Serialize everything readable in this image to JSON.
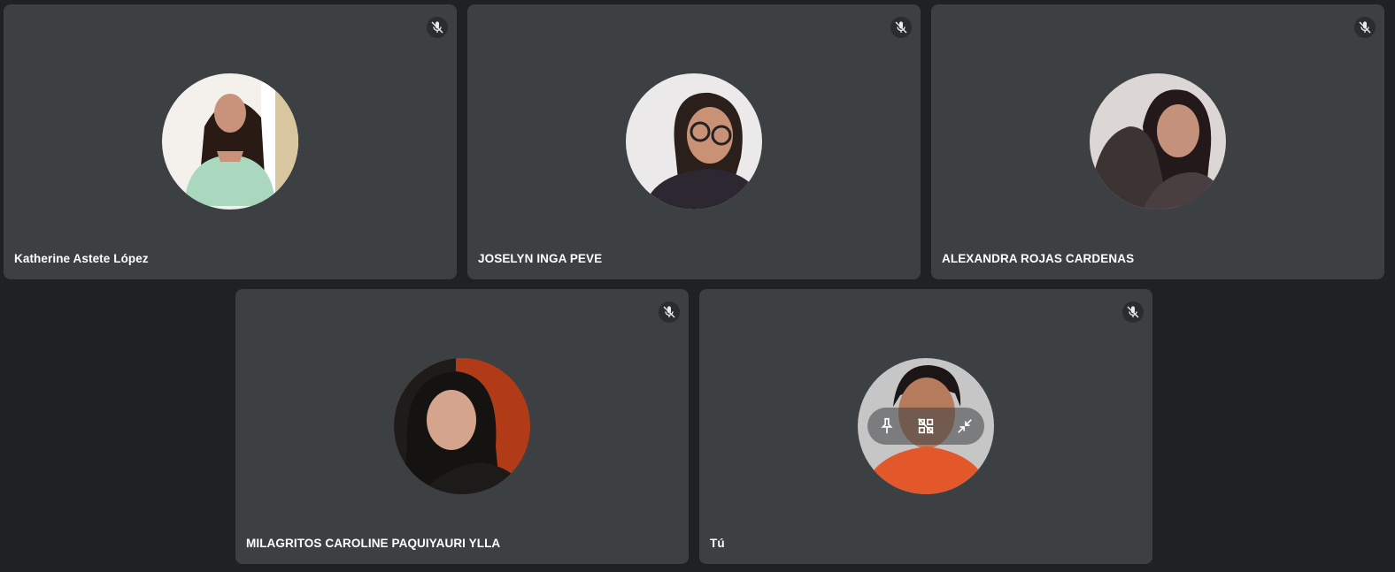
{
  "participants": [
    {
      "name": "Katherine Astete López",
      "muted": true,
      "avatar_bg": "#f2efe9"
    },
    {
      "name": "JOSELYN INGA PEVE",
      "muted": true,
      "avatar_bg": "#e9e7e8"
    },
    {
      "name": "ALEXANDRA ROJAS CARDENAS",
      "muted": true,
      "avatar_bg": "#d9d4d2"
    },
    {
      "name": "MILAGRITOS CAROLINE PAQUIYAURI YLLA",
      "muted": true,
      "avatar_bg": "#b33a16"
    },
    {
      "name": "Tú",
      "muted": true,
      "avatar_bg": "#bdbdbd"
    }
  ],
  "self_tile_controls": [
    "pin-icon",
    "remove-from-grid-icon",
    "minimize-icon"
  ],
  "colors": {
    "background": "#202124",
    "tile": "#3c4043",
    "name_text": "#ffffff",
    "mic_badge": "#2a2c2f"
  }
}
